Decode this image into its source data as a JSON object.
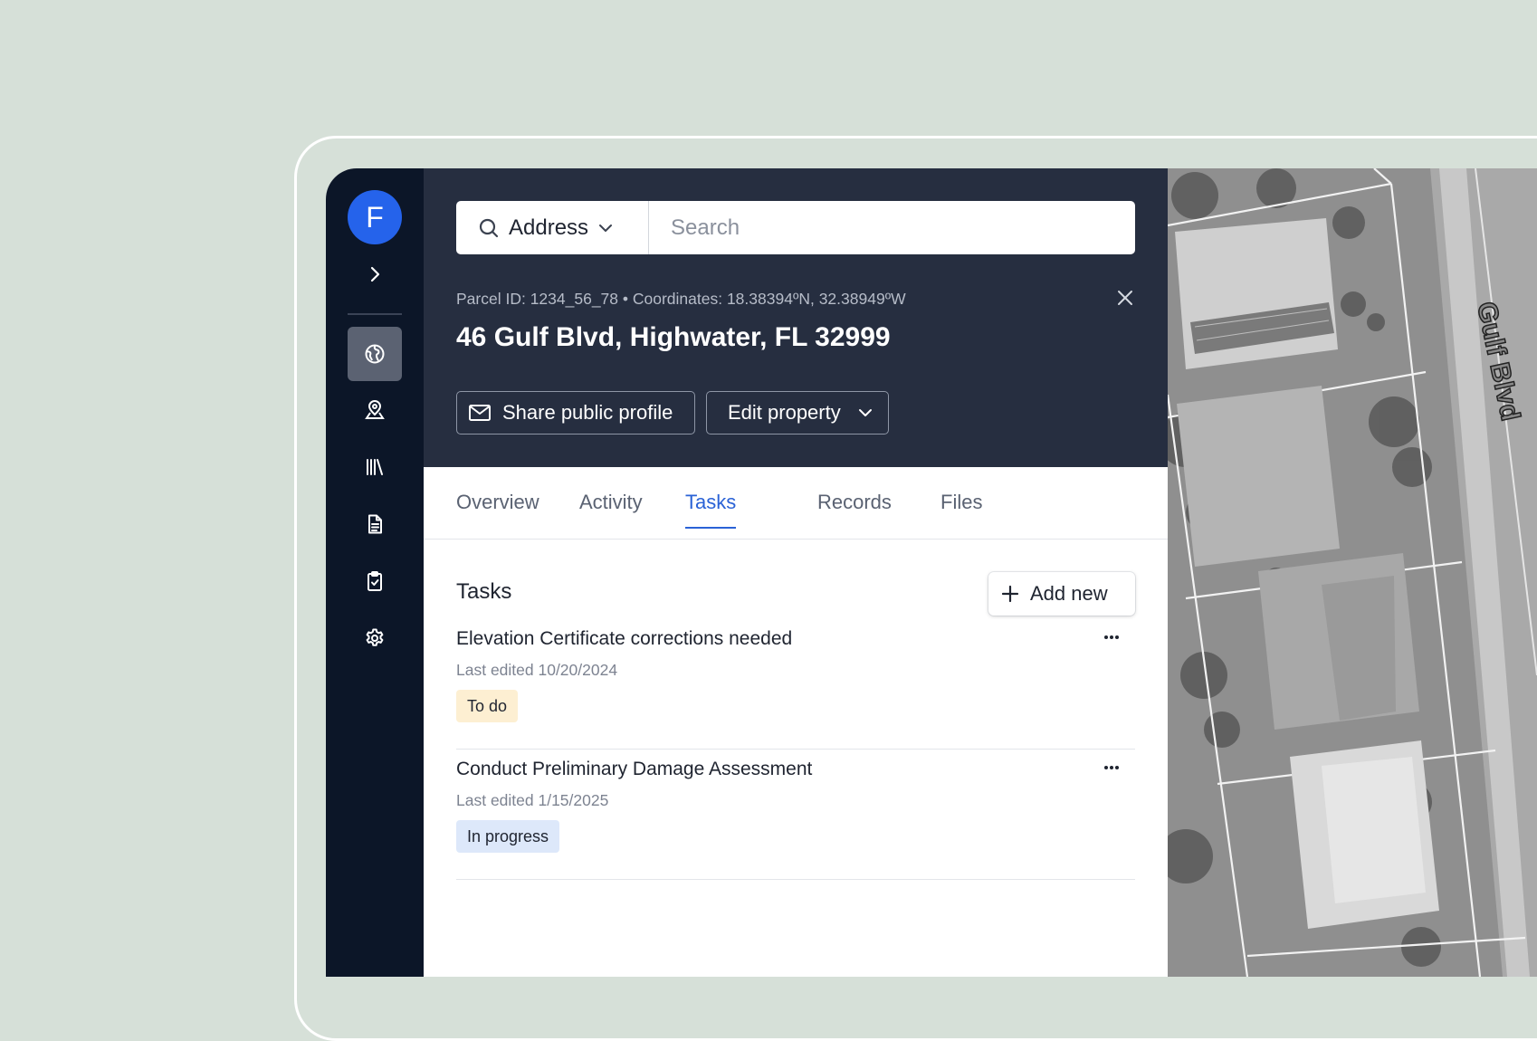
{
  "user": {
    "avatar_initial": "F"
  },
  "sidebar": {
    "items": [
      {
        "icon": "globe-icon",
        "active": true
      },
      {
        "icon": "map-pin-icon",
        "active": false
      },
      {
        "icon": "library-icon",
        "active": false
      },
      {
        "icon": "document-icon",
        "active": false
      },
      {
        "icon": "clipboard-check-icon",
        "active": false
      },
      {
        "icon": "gear-icon",
        "active": false
      }
    ]
  },
  "search": {
    "type_label": "Address",
    "placeholder": "Search",
    "value": ""
  },
  "property": {
    "meta": "Parcel ID: 1234_56_78 • Coordinates: 18.38394ºN, 32.38949ºW",
    "address": "46 Gulf Blvd, Highwater, FL 32999",
    "share_label": "Share public profile",
    "edit_label": "Edit property"
  },
  "tabs": [
    {
      "label": "Overview",
      "active": false
    },
    {
      "label": "Activity",
      "active": false
    },
    {
      "label": "Tasks",
      "active": true
    },
    {
      "label": "Records",
      "active": false
    },
    {
      "label": "Files",
      "active": false
    }
  ],
  "tasks_section": {
    "title": "Tasks",
    "add_label": "Add new",
    "items": [
      {
        "title": "Elevation Certificate corrections needed",
        "edited": "Last edited 10/20/2024",
        "status": "To do"
      },
      {
        "title": "Conduct Preliminary Damage Assessment",
        "edited": "Last edited 1/15/2025",
        "status": "In progress"
      }
    ]
  },
  "map": {
    "street_label": "Gulf Blvd"
  },
  "colors": {
    "accent": "#2a62d6",
    "sidebar_bg": "#0c1628",
    "header_bg": "#262e40",
    "avatar": "#2563eb",
    "badge_todo": "#fdefd2",
    "badge_progress": "#dde8fa"
  }
}
